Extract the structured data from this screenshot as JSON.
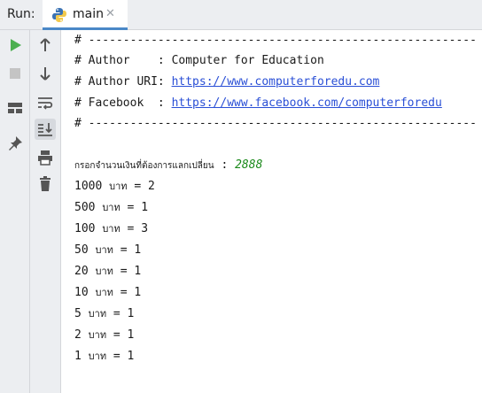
{
  "header": {
    "run_label": "Run:",
    "tab": {
      "title": "main",
      "close_glyph": "✕"
    }
  },
  "toolbar_left": [
    {
      "name": "run-icon",
      "color": "#4caf50"
    },
    {
      "name": "stop-icon",
      "color": "#c4c4c4"
    },
    {
      "name": "layout-icon",
      "color": "#555555"
    },
    {
      "name": "pin-icon",
      "color": "#555555"
    }
  ],
  "toolbar_right": [
    {
      "name": "arrow-up-icon"
    },
    {
      "name": "arrow-down-icon"
    },
    {
      "name": "soft-wrap-icon"
    },
    {
      "name": "scroll-to-end-icon"
    },
    {
      "name": "print-icon"
    },
    {
      "name": "trash-icon"
    }
  ],
  "console": {
    "separator": "# --------------------------------------------------------",
    "author_prefix": "# Author    : ",
    "author_value": "Computer for Education",
    "author_uri_prefix": "# Author URI: ",
    "author_uri_value": "https://www.computerforedu.com",
    "facebook_prefix": "# Facebook  : ",
    "facebook_value": "https://www.facebook.com/computerforedu",
    "prompt_label": "กรอกจำนวนเงินที่ต้องการแลกเปลี่ยน",
    "prompt_colon": " : ",
    "prompt_value": "2888",
    "unit": "บาท",
    "results": [
      {
        "denomination": "1000",
        "count": "2"
      },
      {
        "denomination": "500",
        "count": "1"
      },
      {
        "denomination": "100",
        "count": "3"
      },
      {
        "denomination": "50",
        "count": "1"
      },
      {
        "denomination": "20",
        "count": "1"
      },
      {
        "denomination": "10",
        "count": "1"
      },
      {
        "denomination": "5",
        "count": "1"
      },
      {
        "denomination": "2",
        "count": "1"
      },
      {
        "denomination": "1",
        "count": "1"
      }
    ]
  },
  "colors": {
    "link": "#2a4fd6",
    "input_value": "#1c8a1c",
    "tab_underline": "#4a88c7",
    "panel_bg": "#eceef1"
  }
}
